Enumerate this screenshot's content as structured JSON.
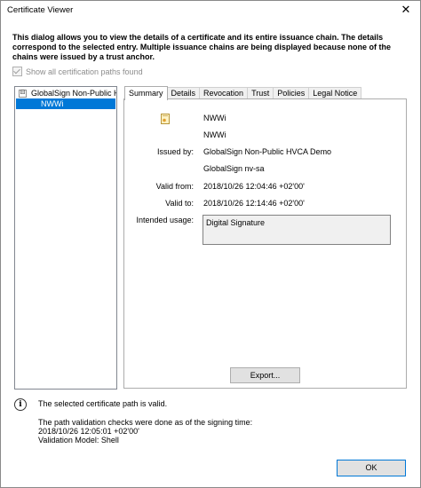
{
  "window": {
    "title": "Certificate Viewer",
    "close_glyph": "✕"
  },
  "description": "This dialog allows you to view the details of a certificate and its entire issuance chain. The details correspond to the selected entry. Multiple issuance chains are being displayed because none of the chains were issued by a trust anchor.",
  "show_all_paths": {
    "label": "Show all certification paths found",
    "checked": true,
    "enabled": false
  },
  "tree": {
    "expander": "⊟",
    "root": "GlobalSign Non-Public H",
    "child": "NWWi"
  },
  "tabs": [
    "Summary",
    "Details",
    "Revocation",
    "Trust",
    "Policies",
    "Legal Notice"
  ],
  "summary": {
    "subject_name": "NWWi",
    "subject_org": "NWWi",
    "issued_by_label": "Issued by:",
    "issuer_name": "GlobalSign Non-Public HVCA Demo",
    "issuer_org": "GlobalSign nv-sa",
    "valid_from_label": "Valid from:",
    "valid_from": "2018/10/26 12:04:46 +02'00'",
    "valid_to_label": "Valid to:",
    "valid_to": "2018/10/26 12:14:46 +02'00'",
    "intended_usage_label": "Intended usage:",
    "intended_usage": "Digital Signature",
    "export_label": "Export..."
  },
  "status": {
    "info_glyph": "i",
    "line1": "The selected certificate path is valid.",
    "line2": "The path validation checks were done as of the signing time:",
    "line3": "2018/10/26 12:05:01 +02'00'",
    "line4": "Validation Model: Shell"
  },
  "ok_label": "OK"
}
